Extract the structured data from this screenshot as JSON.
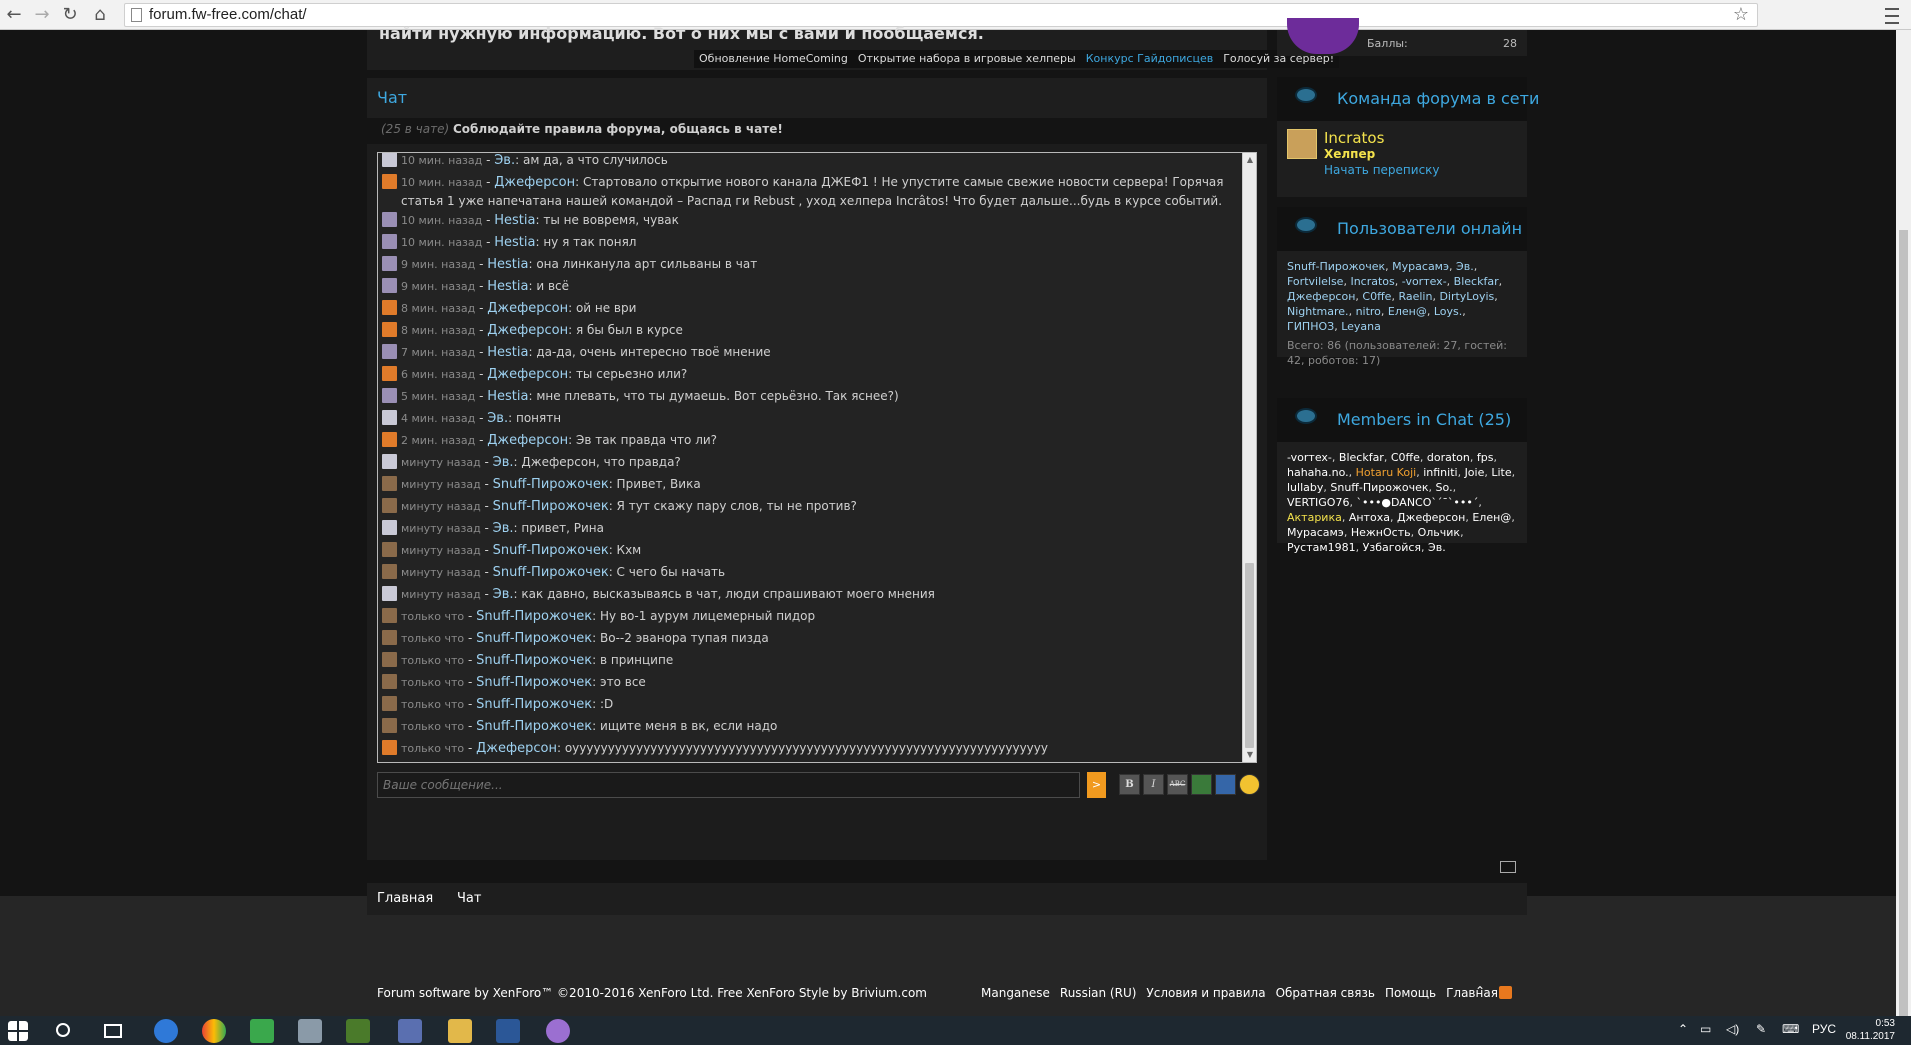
{
  "browser": {
    "url": "forum.fw-free.com/chat/"
  },
  "notice": {
    "text": "найти нужную информацию. Вот о них мы с вами и пообщаемся.",
    "links": [
      "Обновление HomeComing",
      "Открытие набора в игровые хелперы",
      "Конкурс Гайдописцев",
      "Голосуй за сервер!"
    ]
  },
  "chat": {
    "title": "Чат",
    "count": "(25 в чате)",
    "rules": "Соблюдайте правила форума, общаясь в чате!",
    "placeholder": "Ваше сообщение...",
    "send_label": ">",
    "tools": [
      "B",
      "I",
      "ABC",
      "img",
      "link",
      "smile"
    ],
    "messages": [
      {
        "time": "10 мин. назад",
        "user": "Эв.",
        "text": "ам да, а что случилось",
        "avatar": "ev"
      },
      {
        "time": "10 мин. назад",
        "user": "Джеферсон",
        "text": "Стартовало открытие нового канала ДЖЕФ1 ! Не упустите самые свежие новости сервера! Горячая статья 1 уже напечатана нашей командой – Распад ги Rebust , уход хелпера Incrâtos! Что будет дальше...будь в курсе событий.",
        "avatar": "jef"
      },
      {
        "time": "10 мин. назад",
        "user": "Hestia",
        "text": "ты не вовремя, чувак",
        "avatar": "hestia"
      },
      {
        "time": "10 мин. назад",
        "user": "Hestia",
        "text": "ну я так понял",
        "avatar": "hestia"
      },
      {
        "time": "9 мин. назад",
        "user": "Hestia",
        "text": "она линканула арт сильваны в чат",
        "avatar": "hestia"
      },
      {
        "time": "9 мин. назад",
        "user": "Hestia",
        "text": "и всё",
        "avatar": "hestia"
      },
      {
        "time": "8 мин. назад",
        "user": "Джеферсон",
        "text": "ой не ври",
        "avatar": "jef"
      },
      {
        "time": "8 мин. назад",
        "user": "Джеферсон",
        "text": "я бы был в курсе",
        "avatar": "jef"
      },
      {
        "time": "7 мин. назад",
        "user": "Hestia",
        "text": "да-да, очень интересно твоё мнение",
        "avatar": "hestia"
      },
      {
        "time": "6 мин. назад",
        "user": "Джеферсон",
        "text": "ты серьезно или?",
        "avatar": "jef"
      },
      {
        "time": "5 мин. назад",
        "user": "Hestia",
        "text": "мне плевать, что ты думаешь. Вот серьёзно. Так яснее?)",
        "avatar": "hestia"
      },
      {
        "time": "4 мин. назад",
        "user": "Эв.",
        "text": "понятн",
        "avatar": "ev"
      },
      {
        "time": "2 мин. назад",
        "user": "Джеферсон",
        "text": "Эв так правда что ли?",
        "avatar": "jef"
      },
      {
        "time": "минуту назад",
        "user": "Эв.",
        "text": "Джеферсон, что правда?",
        "avatar": "ev"
      },
      {
        "time": "минуту назад",
        "user": "Snuff-Пирожочек",
        "text": "Привет, Вика",
        "avatar": "snuff"
      },
      {
        "time": "минуту назад",
        "user": "Snuff-Пирожочек",
        "text": "Я тут скажу пару слов, ты не против?",
        "avatar": "snuff"
      },
      {
        "time": "минуту назад",
        "user": "Эв.",
        "text": "привет, Рина",
        "avatar": "ev"
      },
      {
        "time": "минуту назад",
        "user": "Snuff-Пирожочек",
        "text": "Кхм",
        "avatar": "snuff"
      },
      {
        "time": "минуту назад",
        "user": "Snuff-Пирожочек",
        "text": "С чего бы начать",
        "avatar": "snuff"
      },
      {
        "time": "минуту назад",
        "user": "Эв.",
        "text": "как давно, высказываясь в чат, люди спрашивают моего мнения",
        "avatar": "ev"
      },
      {
        "time": "только что",
        "user": "Snuff-Пирожочек",
        "text": "Ну во-1 аурум лицемерный пидор",
        "avatar": "snuff"
      },
      {
        "time": "только что",
        "user": "Snuff-Пирожочек",
        "text": "Во--2 эванора тупая пизда",
        "avatar": "snuff"
      },
      {
        "time": "только что",
        "user": "Snuff-Пирожочек",
        "text": "в принципе",
        "avatar": "snuff"
      },
      {
        "time": "только что",
        "user": "Snuff-Пирожочек",
        "text": "это все",
        "avatar": "snuff"
      },
      {
        "time": "только что",
        "user": "Snuff-Пирожочек",
        "text": ":D",
        "avatar": "snuff"
      },
      {
        "time": "только что",
        "user": "Snuff-Пирожочек",
        "text": "ищите меня в вк, если надо",
        "avatar": "snuff"
      },
      {
        "time": "только что",
        "user": "Джеферсон",
        "text": "оууууууууууууууууууууууууууууууууууууууууууууууууууууууууууууууууууу",
        "avatar": "jef"
      }
    ]
  },
  "footer_nav": {
    "home": "Главная",
    "chat": "Чат"
  },
  "sidebar": {
    "points_label": "Баллы:",
    "points_value": "28",
    "team": {
      "title": "Команда форума в сети",
      "member": "Incratos",
      "role": "Хелпер",
      "action": "Начать переписку"
    },
    "online": {
      "title": "Пользователи онлайн",
      "users": [
        "Snuff-Пирожочек",
        "Мурасамэ",
        "Эв.",
        "Fortvilelse",
        "Incratos",
        "-vorтex-",
        "Bleckfar",
        "Джеферсон",
        "C0ffe",
        "Raelin",
        "DirtyLoyis",
        "Nightmare.",
        "nitro",
        "Елен@",
        "Loys.",
        "ГИПНОЗ",
        "Leyana"
      ],
      "total": "Всего: 86 (пользователей: 27, гостей: 42, роботов: 17)"
    },
    "members": {
      "title": "Members in Chat (25)",
      "users": [
        "-vorтex-",
        "Bleckfar",
        "C0ffe",
        "doraton",
        "fps",
        "hahaha.no.",
        "Hotaru Koji",
        "infiniti",
        "Joie",
        "Lite",
        "lullaby",
        "Snuff-Пирожочек",
        "So.",
        "VERTIGO76",
        "`•••●DANCO`´¯`•••´",
        "Актарика",
        "Антоха",
        "Джеферсон",
        "Елен@",
        "Мурасамэ",
        "НежнОсть",
        "Ольчик",
        "Рустам1981",
        "Узбагойся",
        "Эв."
      ]
    }
  },
  "copyright": "Forum software by XenForo™ ©2010-2016 XenForo Ltd. Free XenForo Style by Brivium.com",
  "bottom_links": [
    "Manganese",
    "Russian (RU)",
    "Условия и правила",
    "Обратная связь",
    "Помощь",
    "Главная"
  ],
  "taskbar": {
    "lang": "РУС",
    "time": "0:53",
    "date": "08.11.2017"
  }
}
